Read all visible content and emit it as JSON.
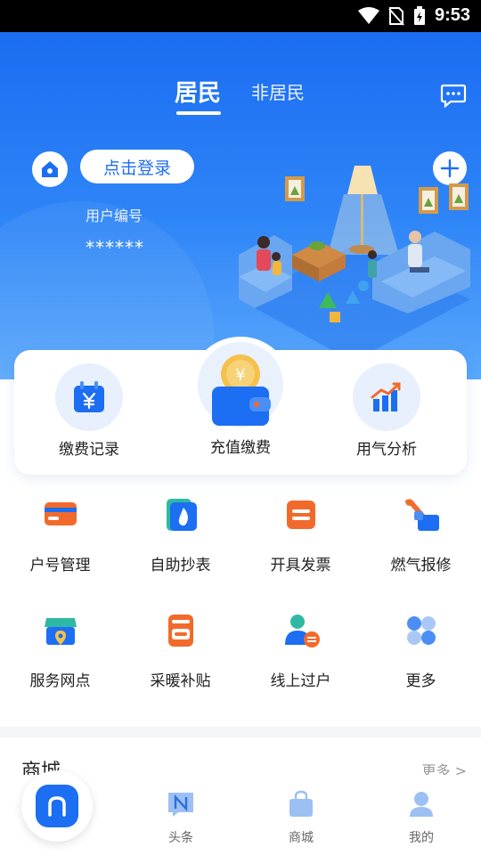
{
  "status_bar": {
    "time": "9:53",
    "icons": [
      "wifi-icon",
      "no-sim-icon",
      "battery-charging-icon"
    ]
  },
  "hero": {
    "tabs": [
      {
        "label": "居民",
        "active": true
      },
      {
        "label": "非居民",
        "active": false
      }
    ],
    "login_label": "点击登录",
    "user_id_label": "用户编号",
    "user_id_value": "******",
    "icons": [
      "message-icon",
      "home-icon",
      "add-icon"
    ]
  },
  "card": {
    "items": [
      {
        "label": "缴费记录",
        "icon": "calendar-yuan-icon"
      },
      {
        "label": "充值缴费",
        "icon": "wallet-coin-icon"
      },
      {
        "label": "用气分析",
        "icon": "bar-chart-icon"
      }
    ]
  },
  "grid": {
    "items": [
      {
        "label": "户号管理",
        "icon": "card-icon"
      },
      {
        "label": "自助抄表",
        "icon": "flame-meter-icon"
      },
      {
        "label": "开具发票",
        "icon": "invoice-icon"
      },
      {
        "label": "燃气报修",
        "icon": "wrench-icon"
      },
      {
        "label": "服务网点",
        "icon": "store-location-icon"
      },
      {
        "label": "采暖补贴",
        "icon": "heating-icon"
      },
      {
        "label": "线上过户",
        "icon": "user-transfer-icon"
      },
      {
        "label": "更多",
        "icon": "more-grid-icon"
      }
    ]
  },
  "mall": {
    "title": "商城",
    "more": "更多 >"
  },
  "bottom_nav": {
    "items": [
      {
        "label": "",
        "icon": "home-icon",
        "active": true
      },
      {
        "label": "头条",
        "icon": "news-icon"
      },
      {
        "label": "商城",
        "icon": "shopping-bag-icon"
      },
      {
        "label": "我的",
        "icon": "profile-icon"
      }
    ]
  },
  "colors": {
    "primary": "#1c6ef2",
    "orange": "#f26a2b",
    "background": "#ffffff"
  }
}
